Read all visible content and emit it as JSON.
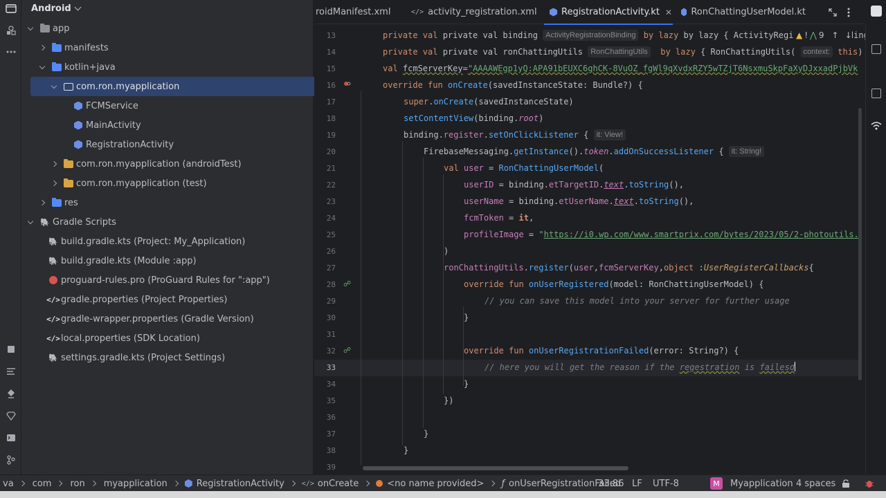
{
  "project_panel": {
    "view_name": "Android",
    "tree": [
      {
        "label": "app"
      },
      {
        "label": "manifests"
      },
      {
        "label": "kotlin+java"
      },
      {
        "label": "com.ron.myapplication"
      },
      {
        "label": "FCMService"
      },
      {
        "label": "MainActivity"
      },
      {
        "label": "RegistrationActivity"
      },
      {
        "label": "com.ron.myapplication (androidTest)"
      },
      {
        "label": "com.ron.myapplication (test)"
      },
      {
        "label": "res"
      },
      {
        "label": "Gradle Scripts"
      },
      {
        "label": "build.gradle.kts (Project: My_Application)"
      },
      {
        "label": "build.gradle.kts (Module :app)"
      },
      {
        "label": "proguard-rules.pro (ProGuard Rules for \":app\")"
      },
      {
        "label": "gradle.properties (Project Properties)"
      },
      {
        "label": "gradle-wrapper.properties (Gradle Version)"
      },
      {
        "label": "local.properties (SDK Location)"
      },
      {
        "label": "settings.gradle.kts (Project Settings)"
      }
    ]
  },
  "tabs": [
    {
      "label": "roidManifest.xml"
    },
    {
      "label": "activity_registration.xml"
    },
    {
      "label": "RegistrationActivity.kt"
    },
    {
      "label": "RonChattingUserModel.kt"
    }
  ],
  "editor": {
    "line_numbers": [
      "13",
      "14",
      "15",
      "16",
      "17",
      "18",
      "19",
      "20",
      "21",
      "22",
      "23",
      "24",
      "25",
      "26",
      "27",
      "28",
      "29",
      "30",
      "31",
      "32",
      "33",
      "34",
      "35",
      "36",
      "37",
      "38",
      "39"
    ],
    "warnings_count": "9",
    "hints": {
      "binding_type": "ActivityRegistrationBinding",
      "utils_type": "RonChattingUtils",
      "context_param": "context:",
      "it_view": "it: View!",
      "it_string": "it: String!"
    },
    "code": {
      "l13a": "private val binding",
      "l13b": "by lazy { ActivityRegistrationBinding.",
      "l14a": "private val ronChattingUtils",
      "l14b": "by lazy { RonChattingUtils(",
      "l14c": "this) }",
      "l15": "\"AAAAWEgp1yQ:APA91bEUXC6ghCK-8VuOZ_fgWl9qXvdxRZY5wTZjT6NsxmuSkpFaXyDJxxadPjbVk",
      "l16": "onCreate(savedInstanceState: Bundle?) {",
      "l17": "onCreate(savedInstanceState)",
      "l18": "setContentView(binding.",
      "l18b": "root",
      "l19": "binding.register.setOnClickListener {",
      "l20a": "FirebaseMessaging.getInstance().",
      "l20b": "token",
      "l20c": ".addOnSuccessListener {",
      "l21": "RonChattingUserModel(",
      "l22a": "userID = binding.etTargetID.",
      "l22b": "text",
      "l22c": ".toString(),",
      "l23a": "userName = binding.etUserName.",
      "l23b": "text",
      "l23c": ".toString(),",
      "l24": "fcmToken = ",
      "l25a": "profileImage = ",
      "l25b": "\"https://i0.wp.com/www.smartprix.com/bytes/2023/05/2-photoutils.",
      "l26": ")",
      "l27a": "ronChattingUtils.register(user,fcmServerKey,",
      "l27b": "UserRegisterCallbacks",
      "l27c": "{",
      "l28": "onUserRegistered(model: RonChattingUserModel) {",
      "l29": "// you can save this model into your server for further usage",
      "l30": "}",
      "l32": "onUserRegistrationFailed(error: String?) {",
      "l33a": "// here you will get the reason if the ",
      "l33b": "regestration",
      "l33c": " is ",
      "l33d": "failesd",
      "l34": "}",
      "l35": "})",
      "l37": "}",
      "l38": "}"
    }
  },
  "statusbar": {
    "crumbs": [
      "va",
      "com",
      "ron",
      "myapplication",
      "RegistrationActivity",
      "onCreate",
      "<no name provided>",
      "onUserRegistrationFailed"
    ],
    "position": "33:86",
    "line_sep": "LF",
    "encoding": "UTF-8",
    "module_badge": "M",
    "module": "Myapplication",
    "indent": "4 spaces"
  },
  "colors": {
    "accent": "#3574f0",
    "selection": "#2e436e",
    "keyword": "#cf8e6d",
    "function": "#56a8f5",
    "string": "#6aab73",
    "comment": "#7a7e85"
  }
}
